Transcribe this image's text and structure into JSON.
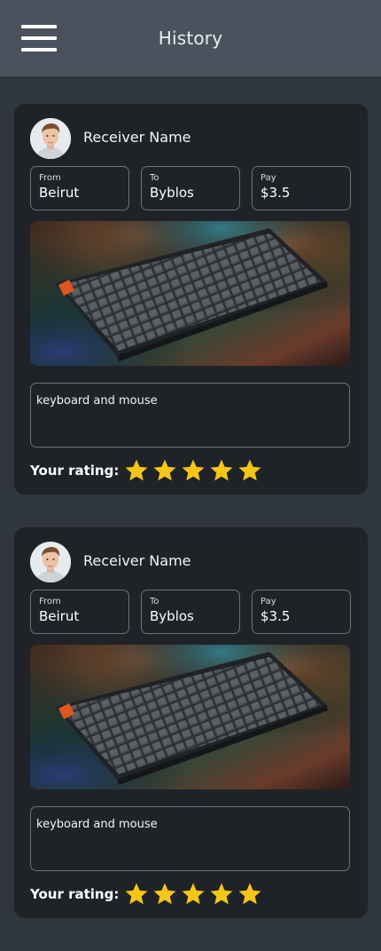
{
  "header": {
    "title": "History"
  },
  "orders": [
    {
      "receiver_name": "Receiver Name",
      "from_label": "From",
      "from_value": "Beirut",
      "to_label": "To",
      "to_value": "Byblos",
      "pay_label": "Pay",
      "pay_value": "$3.5",
      "image_subject": "keyboard",
      "description": "keyboard and mouse",
      "rating_label": "Your rating:",
      "rating": 5,
      "rating_max": 5
    },
    {
      "receiver_name": "Receiver Name",
      "from_label": "From",
      "from_value": "Beirut",
      "to_label": "To",
      "to_value": "Byblos",
      "pay_label": "Pay",
      "pay_value": "$3.5",
      "image_subject": "keyboard",
      "description": "keyboard and mouse",
      "rating_label": "Your rating:",
      "rating": 5,
      "rating_max": 5
    }
  ],
  "colors": {
    "star": "#f5c518",
    "card": "#1f2327",
    "header": "#4a535d",
    "background": "#2f363d"
  },
  "icons": {
    "menu": "hamburger-menu-icon",
    "star": "star-icon"
  }
}
